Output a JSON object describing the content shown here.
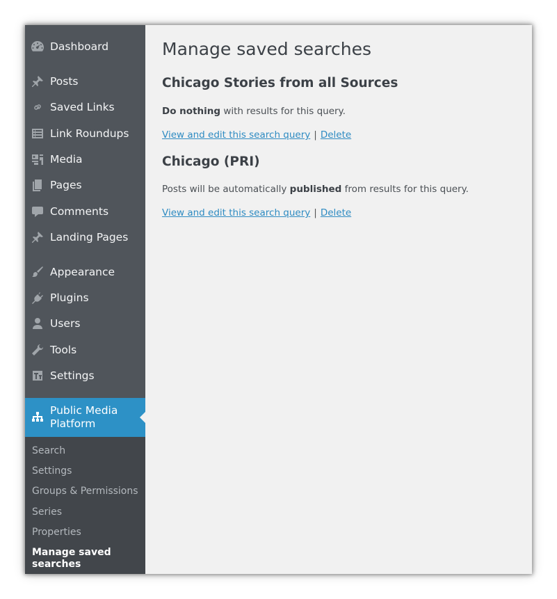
{
  "page": {
    "title": "Manage saved searches"
  },
  "sidebar": {
    "items": [
      {
        "label": "Dashboard",
        "icon": "dashboard-icon"
      },
      {
        "label": "Posts",
        "icon": "pin-icon"
      },
      {
        "label": "Saved Links",
        "icon": "link-icon"
      },
      {
        "label": "Link Roundups",
        "icon": "list-icon"
      },
      {
        "label": "Media",
        "icon": "media-icon"
      },
      {
        "label": "Pages",
        "icon": "pages-icon"
      },
      {
        "label": "Comments",
        "icon": "comment-icon"
      },
      {
        "label": "Landing Pages",
        "icon": "pin-icon"
      },
      {
        "label": "Appearance",
        "icon": "brush-icon"
      },
      {
        "label": "Plugins",
        "icon": "plugin-icon"
      },
      {
        "label": "Users",
        "icon": "user-icon"
      },
      {
        "label": "Tools",
        "icon": "wrench-icon"
      },
      {
        "label": "Settings",
        "icon": "settings-icon"
      },
      {
        "label": "Public Media Platform",
        "icon": "sitemap-icon"
      }
    ],
    "submenu": [
      {
        "label": "Search"
      },
      {
        "label": "Settings"
      },
      {
        "label": "Groups & Permissions"
      },
      {
        "label": "Series"
      },
      {
        "label": "Properties"
      },
      {
        "label": "Manage saved searches"
      }
    ]
  },
  "searches": [
    {
      "title": "Chicago Stories from all Sources",
      "desc_bold": "Do nothing",
      "desc_rest": " with results for this query.",
      "edit_label": "View and edit this search query",
      "separator": "|",
      "delete_label": "Delete"
    },
    {
      "title": "Chicago (PRI)",
      "desc_prefix": "Posts will be automatically ",
      "desc_bold": "published",
      "desc_rest": " from results for this query.",
      "edit_label": "View and edit this search query",
      "separator": "|",
      "delete_label": "Delete"
    }
  ],
  "colors": {
    "sidebar_bg": "#50555b",
    "submenu_bg": "#42464b",
    "active_bg": "#2d91c6",
    "link": "#2e8bc2",
    "content_bg": "#f1f1f1"
  }
}
